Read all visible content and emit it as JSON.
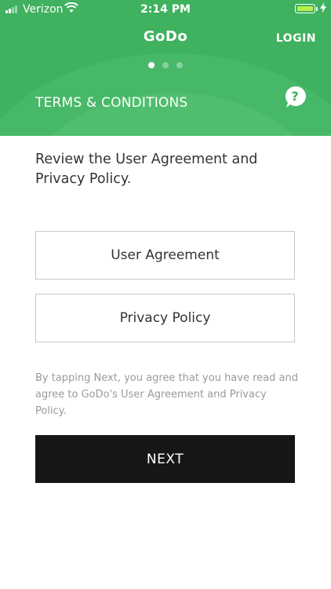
{
  "status_bar": {
    "carrier": "Verizon",
    "time": "2:14 PM",
    "battery_fill_color": "#b6f04a"
  },
  "header": {
    "app_title": "GoDo",
    "login_label": "LOGIN",
    "section_title": "TERMS & CONDITIONS",
    "help_icon_glyph": "?",
    "pager": {
      "count": 3,
      "active_index": 0
    },
    "background_color": "#3fb15f"
  },
  "main": {
    "intro_text": "Review the User Agreement and Privacy Policy.",
    "user_agreement_label": "User Agreement",
    "privacy_policy_label": "Privacy Policy",
    "disclaimer_text": "By tapping Next, you agree that you have read and agree to GoDo's User Agreement and Privacy Policy.",
    "next_label": "NEXT"
  }
}
